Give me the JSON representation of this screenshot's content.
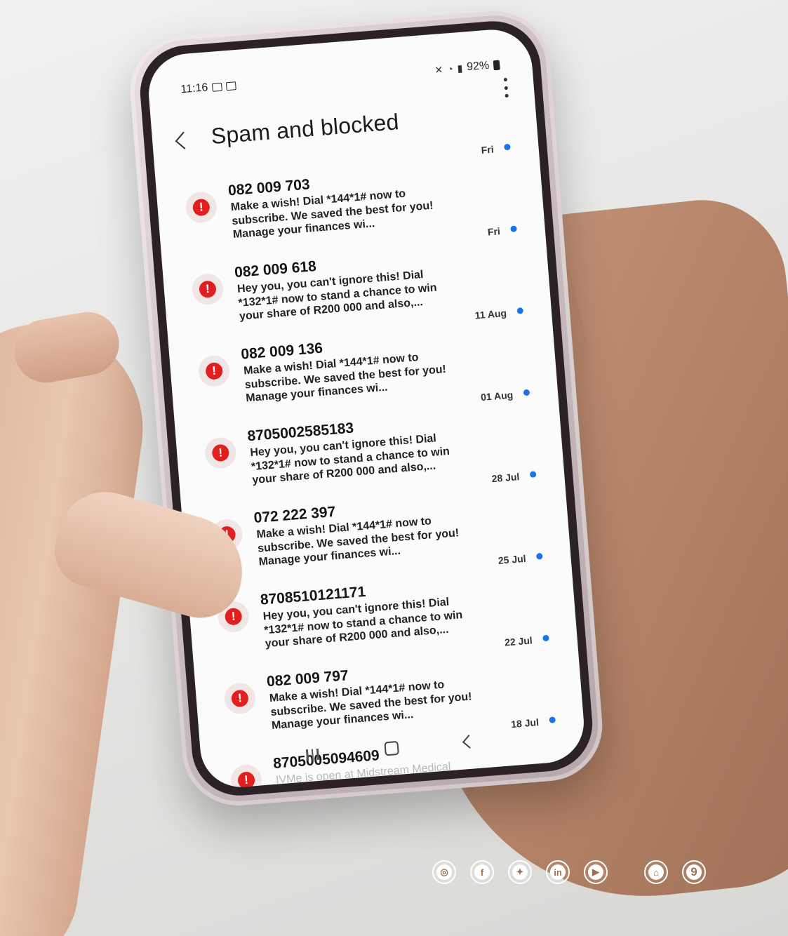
{
  "status_bar": {
    "time": "11:16",
    "battery": "92%"
  },
  "header": {
    "title": "Spam and blocked"
  },
  "messages": [
    {
      "sender": "082 009 703",
      "snippet": "Make a wish! Dial *144*1# now to subscribe. We saved the best for you! Manage your finances wi...",
      "date": "Fri"
    },
    {
      "sender": "082 009 618",
      "snippet": "Hey you, you can't ignore this! Dial *132*1# now to stand a chance to win your share of R200 000 and also,...",
      "date": "Fri"
    },
    {
      "sender": "082 009 136",
      "snippet": "Make a wish! Dial *144*1# now to subscribe. We saved the best for you! Manage your finances wi...",
      "date": "11 Aug"
    },
    {
      "sender": "8705002585183",
      "snippet": "Hey you, you can't ignore this! Dial *132*1# now to stand a chance to win your share of R200 000 and also,...",
      "date": "01 Aug"
    },
    {
      "sender": "072 222 397",
      "snippet": "Make a wish! Dial *144*1# now to subscribe. We saved the best for you! Manage your finances wi...",
      "date": "28 Jul"
    },
    {
      "sender": "8708510121171",
      "snippet": "Hey you, you can't ignore this! Dial *132*1# now to stand a chance to win your share of R200 000 and also,...",
      "date": "25 Jul"
    },
    {
      "sender": "082 009 797",
      "snippet": "Make a wish! Dial *144*1# now to subscribe. We saved the best for you! Manage your finances wi...",
      "date": "22 Jul"
    },
    {
      "sender": "8705005094609",
      "snippet": "IVMe is open at Midstream Medical Centre, a Vitamin Therapy Lounge! For more information call...",
      "date": "18 Jul"
    }
  ],
  "footer": {
    "icons": [
      "instagram-icon",
      "facebook-icon",
      "twitter-icon",
      "linkedin-icon",
      "youtube-icon",
      "home-icon"
    ],
    "page_number": "9"
  },
  "colors": {
    "spam_red": "#e0201e",
    "unread_blue": "#1a73e8",
    "accent_brown": "#9e6f55"
  }
}
